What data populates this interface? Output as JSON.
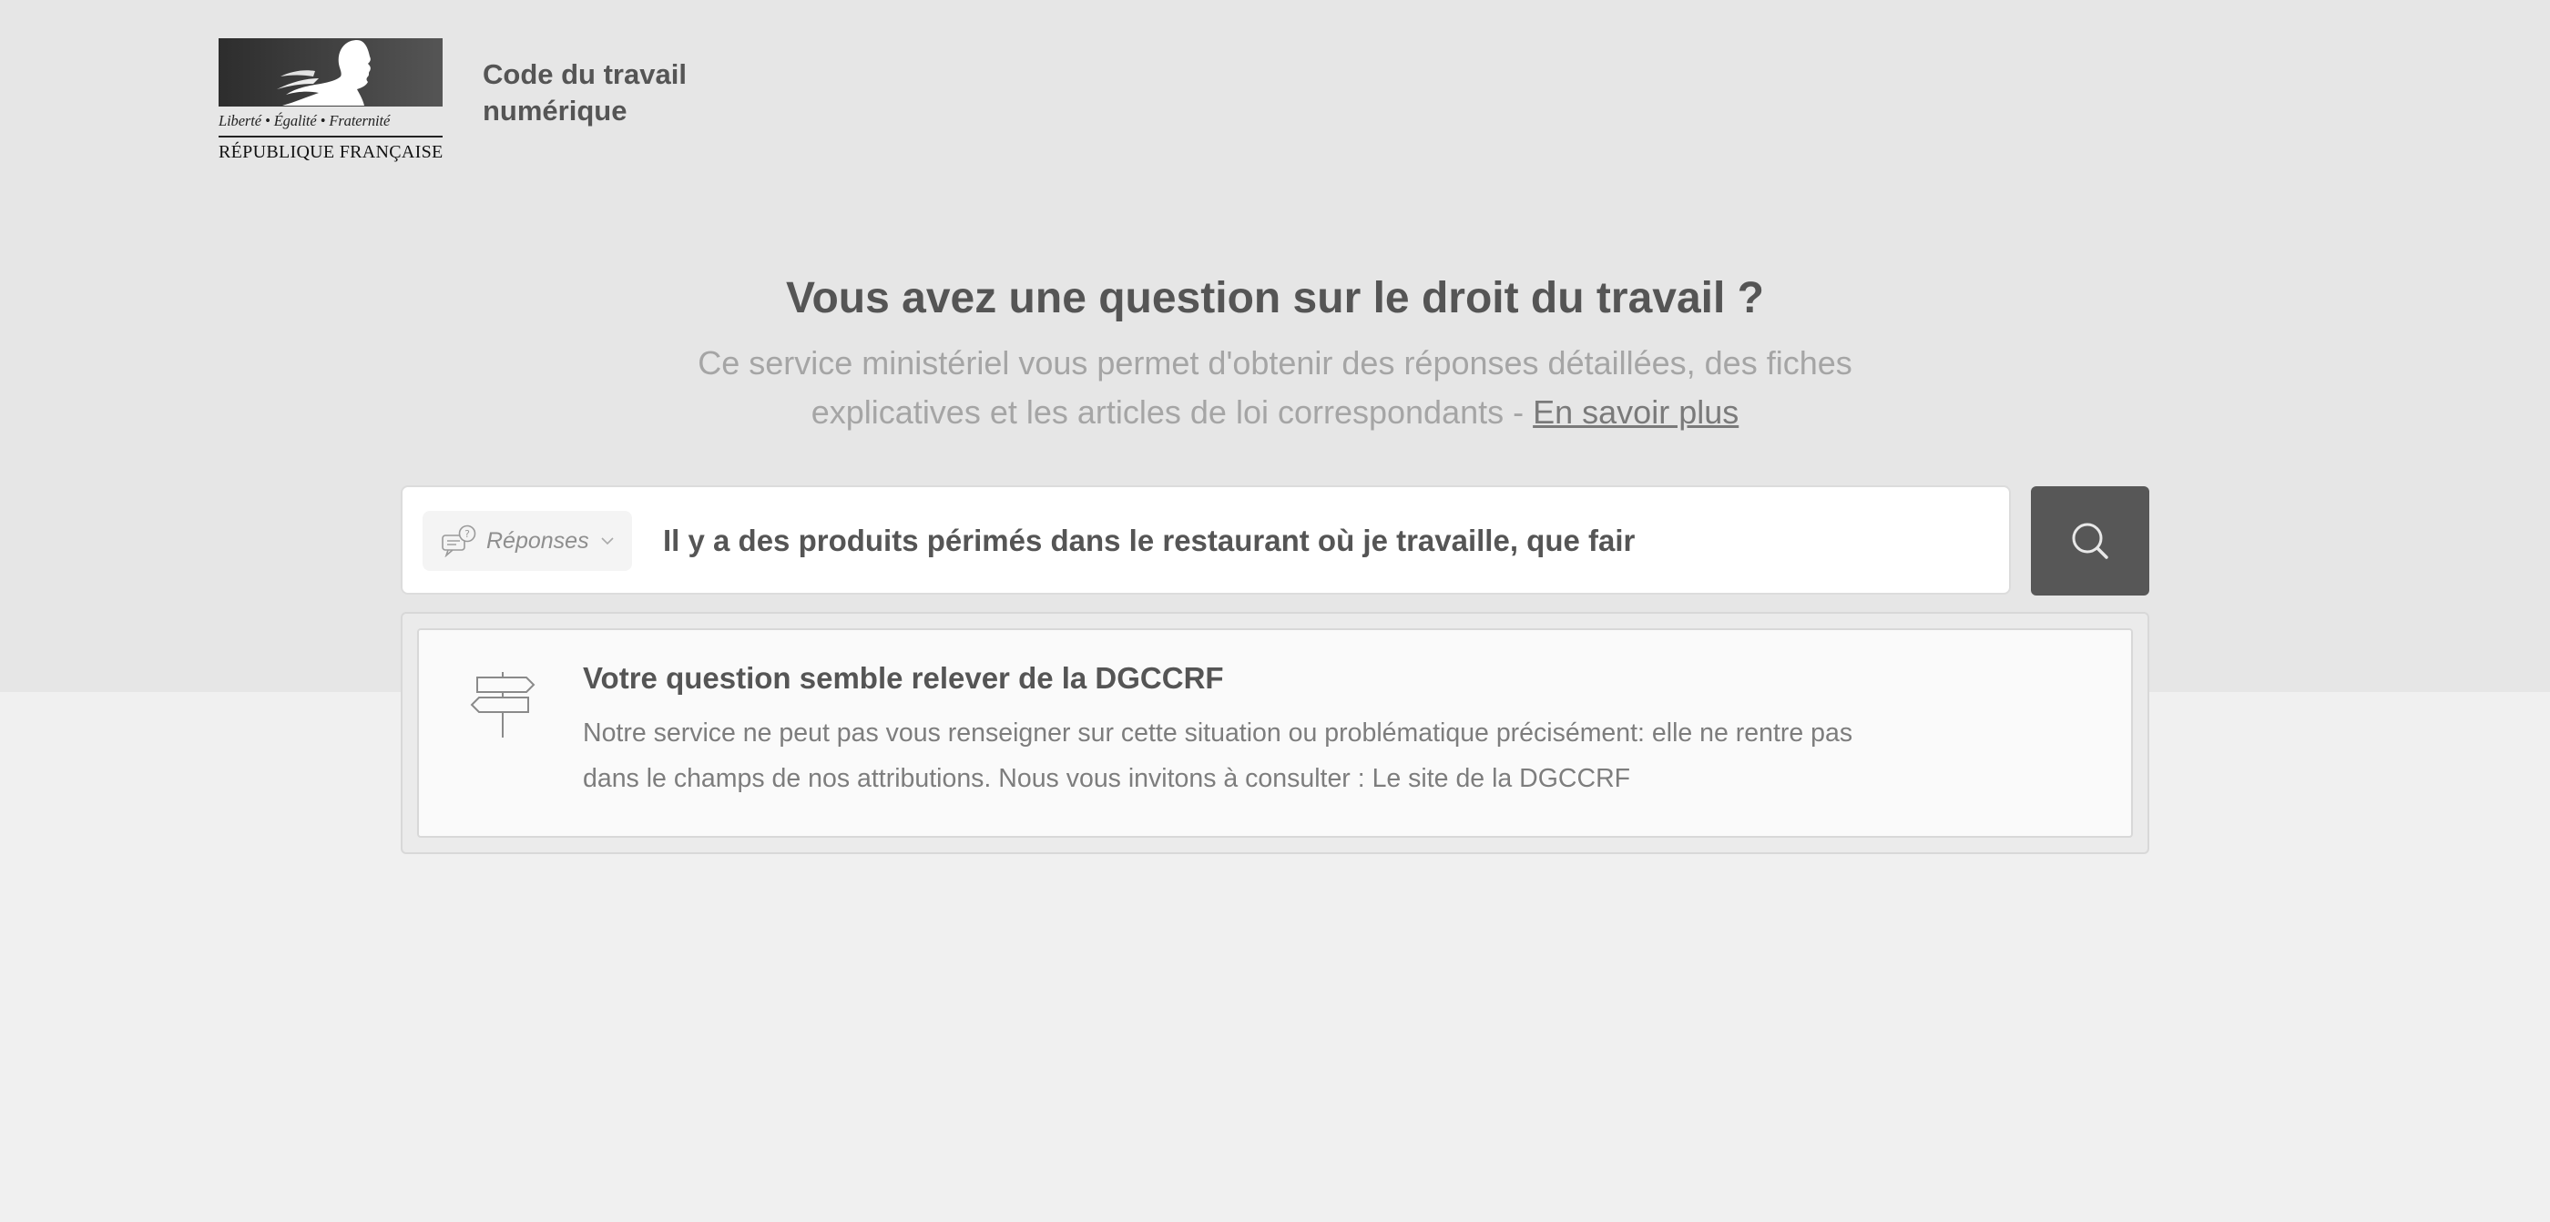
{
  "header": {
    "logo": {
      "motto": "Liberté • Égalité • Fraternité",
      "country": "RÉPUBLIQUE FRANÇAISE"
    },
    "site_title": "Code du travail\nnumérique"
  },
  "hero": {
    "headline": "Vous avez une question sur le droit du travail ?",
    "intro_text": "Ce service ministériel vous permet d'obtenir des réponses détaillées, des fiches explicatives et les articles de loi correspondants - ",
    "intro_link": "En savoir plus"
  },
  "search": {
    "facet_label": "Réponses",
    "facet_icon": "speech-bubble-question-icon",
    "query": "Il y a des produits périmés dans le restaurant où je travaille, que fair",
    "button_icon": "search-icon"
  },
  "results": {
    "card": {
      "icon": "signpost-icon",
      "title": "Votre question semble relever de la DGCCRF",
      "description": "Notre service ne peut pas vous renseigner sur cette situation ou problématique précisément: elle ne rentre pas dans le champs de nos attributions. Nous vous invitons à consulter : ",
      "link_text": "Le site de la DGCCRF"
    }
  },
  "colors": {
    "hero_background": "#e6e6e6",
    "page_background": "#f0f0f0",
    "search_button": "#575757",
    "text_primary": "#555555",
    "text_muted": "#a5a5a5"
  }
}
